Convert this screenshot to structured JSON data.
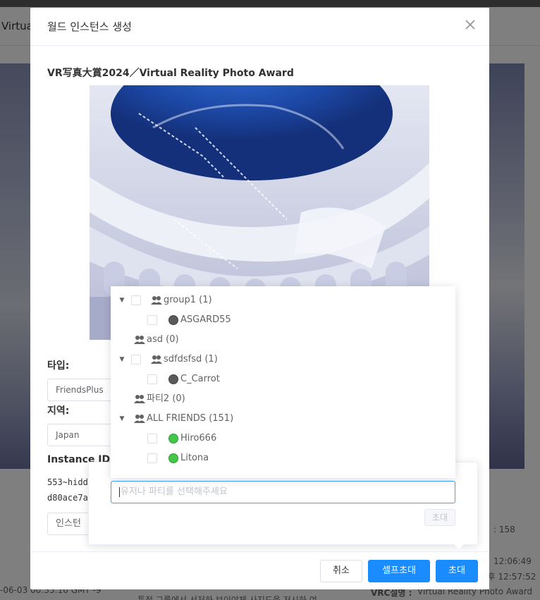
{
  "background": {
    "title": "Virtua",
    "date_text": "-06-03 00:35:10 GMT -9",
    "bottom_text": "특정 그룹에서 서저하 보이야체 사지드을 저시하 여",
    "stat_text": ": 158",
    "time_text_1": "12:06:49",
    "time_text_2": "2후 12:57:52",
    "vrc_label": "VRC설명 :",
    "vrc_value": "Virtual Reality Photo Award"
  },
  "dialog": {
    "title": "월드 인스턴스 생성",
    "world_name": "VR写真大賞2024／Virtual Reality Photo Award",
    "type_label": "타입:",
    "type_value": "FriendsPlus",
    "region_label": "지역:",
    "region_value": "Japan",
    "instance_id_label": "Instance ID:",
    "instance_id_line1": "553~hidd",
    "instance_id_line2": "d80ace7a",
    "instance_button": "인스턴",
    "footer": {
      "cancel": "취소",
      "self_invite": "셀프초대",
      "invite": "초대"
    }
  },
  "invite_popover": {
    "placeholder": "유저나 파티를 선택해주세요",
    "invite_button": "초대"
  },
  "tree": [
    {
      "type": "group",
      "expanded": true,
      "checkbox": true,
      "label": "group1 (1)"
    },
    {
      "type": "user",
      "status": "offline",
      "label": "ASGARD55"
    },
    {
      "type": "group",
      "expanded": false,
      "checkbox": false,
      "label": "asd (0)"
    },
    {
      "type": "group",
      "expanded": true,
      "checkbox": true,
      "label": "sdfdsfsd (1)"
    },
    {
      "type": "user",
      "status": "offline",
      "label": "C_Carrot"
    },
    {
      "type": "group",
      "expanded": false,
      "checkbox": false,
      "label": "파티2 (0)"
    },
    {
      "type": "group",
      "expanded": true,
      "checkbox": false,
      "label": "ALL FRIENDS (151)"
    },
    {
      "type": "user",
      "status": "online",
      "label": "Hiro666"
    },
    {
      "type": "user",
      "status": "online",
      "label": "Litona"
    }
  ],
  "colors": {
    "primary": "#1a8cff",
    "online": "#43c64a",
    "offline": "#5a5a5a",
    "focus_border": "#409eff"
  },
  "icons": {
    "close": "close-icon",
    "group": "users-icon",
    "expand": "caret-down-icon"
  }
}
